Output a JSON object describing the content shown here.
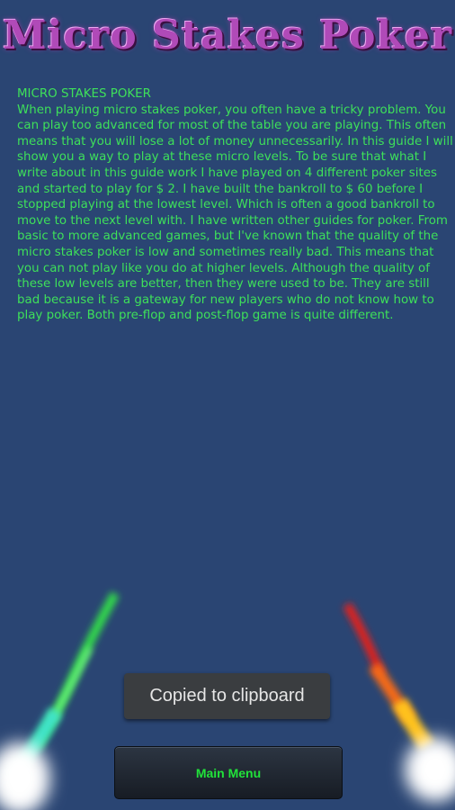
{
  "header": {
    "title": "Micro Stakes Poker"
  },
  "article": {
    "heading": "MICRO STAKES POKER",
    "body": "When playing micro stakes poker, you often have a tricky problem. You can play too advanced for most of the table you are playing. This often means that you will lose a lot of money unnecessarily. In this guide I will show you a way to play at these micro levels. To be sure that what I write about in this guide work I have played on 4 different poker sites and started to play for $ 2. I have built the bankroll to $ 60 before I stopped playing at the lowest level. Which is often a good bankroll to move to the next level with. I have written other guides for poker. From basic to more advanced games, but I've known that the quality of the micro stakes poker is low and sometimes really bad. This means that you can not play like you do at higher levels. Although the quality of these low levels are better, then they were used to be. They are still bad because it is a gateway for new players who do not know how to play poker. Both pre-flop and post-flop game is quite different."
  },
  "toast": {
    "text": "Copied to clipboard"
  },
  "footer": {
    "main_menu_label": "Main Menu"
  },
  "colors": {
    "background": "#2a4573",
    "title": "#b04ab8",
    "body_text": "#3ee05a",
    "button_text": "#21e23a"
  }
}
